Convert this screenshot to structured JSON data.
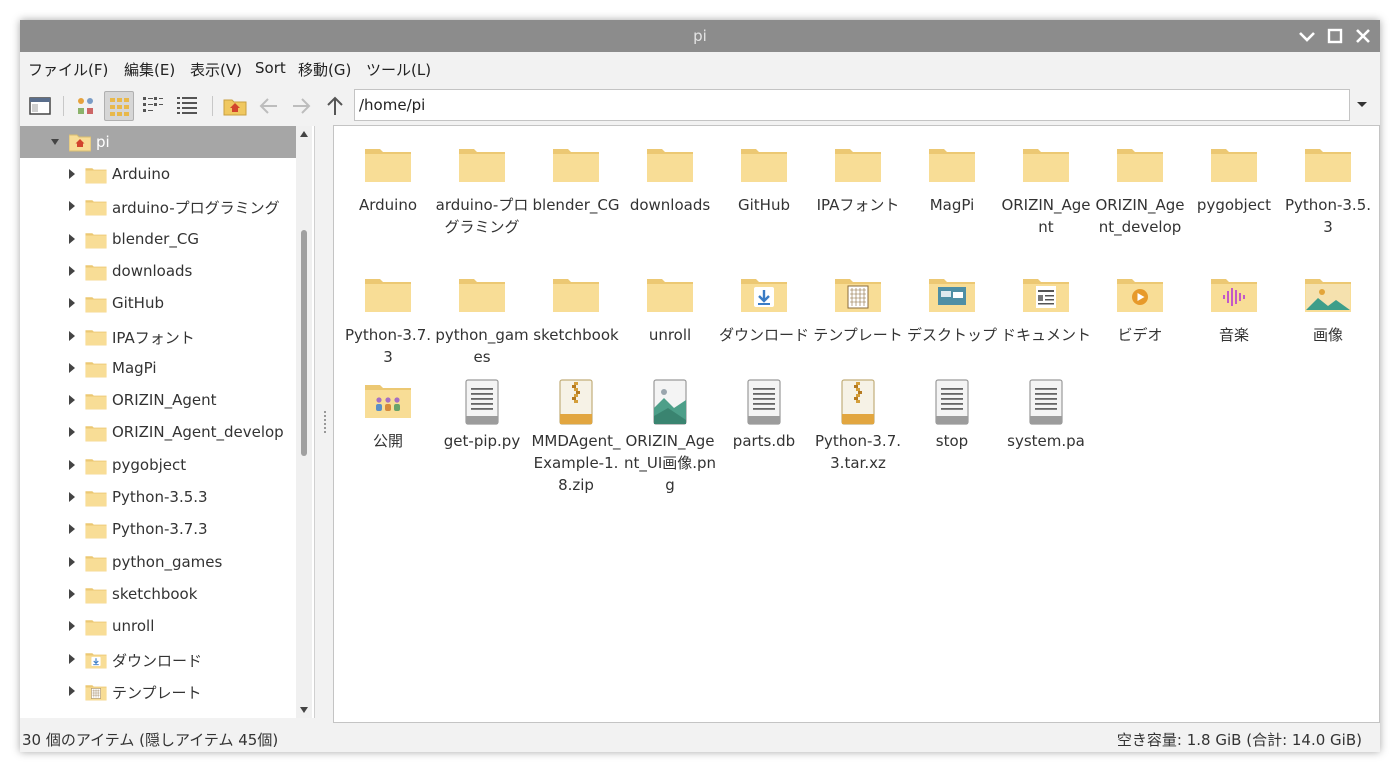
{
  "window": {
    "title": "pi"
  },
  "menu": [
    "ファイル(F)",
    "編集(E)",
    "表示(V)",
    "Sort",
    "移動(G)",
    "ツール(L)"
  ],
  "address": {
    "path": "/home/pi"
  },
  "sidebar": {
    "root": "pi",
    "items": [
      {
        "label": "Arduino",
        "icon": "folder-icon"
      },
      {
        "label": "arduino-プログラミング",
        "icon": "folder-icon"
      },
      {
        "label": "blender_CG",
        "icon": "folder-icon"
      },
      {
        "label": "downloads",
        "icon": "folder-icon"
      },
      {
        "label": "GitHub",
        "icon": "folder-icon"
      },
      {
        "label": "IPAフォント",
        "icon": "folder-icon"
      },
      {
        "label": "MagPi",
        "icon": "folder-icon"
      },
      {
        "label": "ORIZIN_Agent",
        "icon": "folder-icon"
      },
      {
        "label": "ORIZIN_Agent_develop",
        "icon": "folder-icon"
      },
      {
        "label": "pygobject",
        "icon": "folder-icon"
      },
      {
        "label": "Python-3.5.3",
        "icon": "folder-icon"
      },
      {
        "label": "Python-3.7.3",
        "icon": "folder-icon"
      },
      {
        "label": "python_games",
        "icon": "folder-icon"
      },
      {
        "label": "sketchbook",
        "icon": "folder-icon"
      },
      {
        "label": "unroll",
        "icon": "folder-icon"
      },
      {
        "label": "ダウンロード",
        "icon": "downloads-folder-icon"
      },
      {
        "label": "テンプレート",
        "icon": "templates-folder-icon"
      }
    ]
  },
  "files": {
    "row1": [
      {
        "label": "Arduino",
        "icon": "folder-icon"
      },
      {
        "label": "arduino-プログラミング",
        "icon": "folder-icon"
      },
      {
        "label": "blender_CG",
        "icon": "folder-icon"
      },
      {
        "label": "downloads",
        "icon": "folder-icon"
      },
      {
        "label": "GitHub",
        "icon": "folder-icon"
      },
      {
        "label": "IPAフォント",
        "icon": "folder-icon"
      },
      {
        "label": "MagPi",
        "icon": "folder-icon"
      },
      {
        "label": "ORIZIN_Agent",
        "icon": "folder-icon"
      },
      {
        "label": "ORIZIN_Agent_develop",
        "icon": "folder-icon"
      },
      {
        "label": "pygobject",
        "icon": "folder-icon"
      },
      {
        "label": "Python-3.5.3",
        "icon": "folder-icon"
      }
    ],
    "row2": [
      {
        "label": "Python-3.7.3",
        "icon": "folder-icon"
      },
      {
        "label": "python_games",
        "icon": "folder-icon"
      },
      {
        "label": "sketchbook",
        "icon": "folder-icon"
      },
      {
        "label": "unroll",
        "icon": "folder-icon"
      },
      {
        "label": "ダウンロード",
        "icon": "downloads-folder-icon"
      },
      {
        "label": "テンプレート",
        "icon": "templates-folder-icon"
      },
      {
        "label": "デスクトップ",
        "icon": "desktop-folder-icon"
      },
      {
        "label": "ドキュメント",
        "icon": "documents-folder-icon"
      },
      {
        "label": "ビデオ",
        "icon": "videos-folder-icon"
      },
      {
        "label": "音楽",
        "icon": "music-folder-icon"
      },
      {
        "label": "画像",
        "icon": "pictures-folder-icon"
      }
    ],
    "row3": [
      {
        "label": "公開",
        "icon": "public-folder-icon"
      },
      {
        "label": "get-pip.py",
        "icon": "text-file-icon"
      },
      {
        "label": "MMDAgent_Example-1.8.zip",
        "icon": "archive-file-icon"
      },
      {
        "label": "ORIZIN_Agent_UI画像.png",
        "icon": "image-file-icon"
      },
      {
        "label": "parts.db",
        "icon": "text-file-icon"
      },
      {
        "label": "Python-3.7.3.tar.xz",
        "icon": "archive-file-icon"
      },
      {
        "label": "stop",
        "icon": "text-file-icon"
      },
      {
        "label": "system.pa",
        "icon": "text-file-icon"
      }
    ]
  },
  "status": {
    "left": "30 個のアイテム (隠しアイテム 45個)",
    "right": "空き容量: 1.8 GiB (合計: 14.0 GiB)"
  },
  "colors": {
    "titlebar": "#8c8c8c",
    "folder": "#f8dd96",
    "selection": "#a6a6a6"
  }
}
